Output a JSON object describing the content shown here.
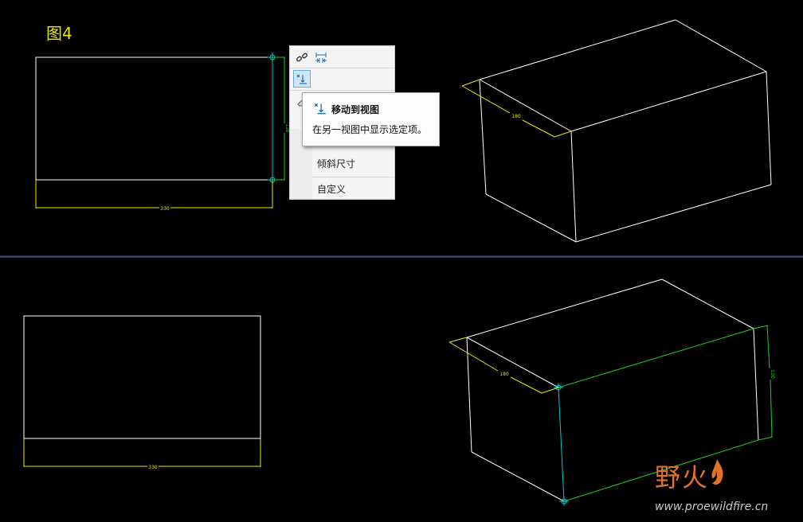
{
  "figure_label": "图4",
  "dimensions": {
    "top_front_width": "330",
    "top_front_height": "120",
    "top_iso_depth": "180",
    "bottom_front_width": "330",
    "bottom_iso_depth": "180",
    "bottom_iso_height": "120"
  },
  "mini_toolbar": {
    "icons": [
      "chain-link-icon",
      "dimension-icon",
      "move-to-view-icon",
      "eraser-icon"
    ],
    "menu_items": [
      "倾斜尺寸",
      "自定义"
    ]
  },
  "tooltip": {
    "title": "移动到视图",
    "description": "在另一视图中显示选定项。"
  },
  "watermark": {
    "text": "野火",
    "url": "www.proewildfire.cn"
  },
  "colors": {
    "background": "#000000",
    "geometry": "#ffffff",
    "dimension": "#e8e800",
    "selected": "#00c8c8",
    "highlight": "#22cc22",
    "watermark": "#e2722a"
  }
}
